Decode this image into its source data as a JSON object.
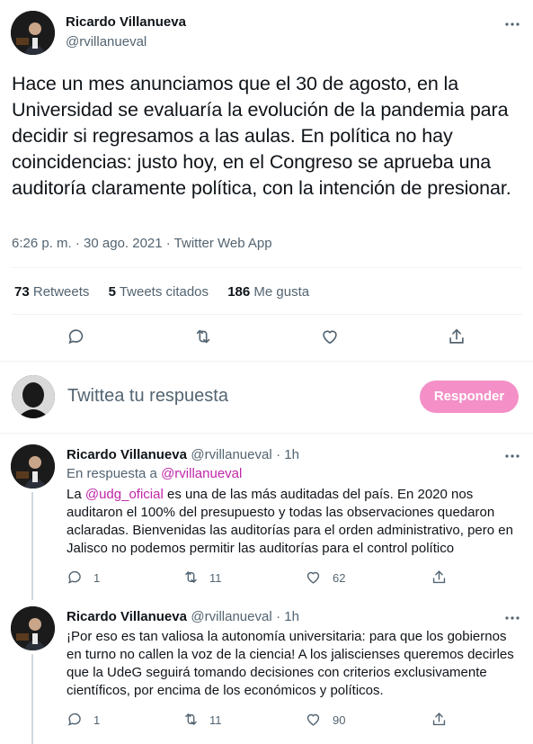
{
  "main_tweet": {
    "author_name": "Ricardo Villanueva",
    "author_handle": "@rvillanueval",
    "text": "Hace un mes anunciamos que el 30 de agosto, en la Universidad se evaluaría la evolución de la pandemia para decidir si regresamos a las aulas. En política no hay coincidencias: justo hoy, en el Congreso se aprueba una auditoría claramente política, con la intención de presionar.",
    "timestamp": "6:26 p. m. · 30 ago. 2021 · Twitter Web App",
    "stats": {
      "retweets_count": "73",
      "retweets_label": "Retweets",
      "quotes_count": "5",
      "quotes_label": "Tweets citados",
      "likes_count": "186",
      "likes_label": "Me gusta"
    },
    "more_icon": "more-dots-icon"
  },
  "composer": {
    "placeholder": "Twittea tu respuesta",
    "reply_button": "Responder"
  },
  "replies": [
    {
      "author_name": "Ricardo Villanueva",
      "author_handle": "@rvillanueval",
      "time": "· 1h",
      "in_reply_prefix": "En respuesta a",
      "in_reply_handle": "@rvillanueval",
      "text_prefix": "La",
      "mention": "@udg_oficial",
      "text": "es una de las más auditadas del país. En 2020 nos auditaron el 100% del presupuesto y todas las observaciones quedaron aclaradas. Bienvenidas las auditorías para el orden administrativo, pero en Jalisco no podemos permitir las auditorías para el control político",
      "reply_count": "1",
      "retweet_count": "11",
      "like_count": "62"
    },
    {
      "author_name": "Ricardo Villanueva",
      "author_handle": "@rvillanueval",
      "time": "· 1h",
      "text": "¡Por eso es tan valiosa la autonomía universitaria: para que los gobiernos en turno no callen la voz de la ciencia! A los jaliscienses queremos decirles que la UdeG seguirá tomando decisiones con criterios exclusivamente científicos, por encima de los económicos y políticos.",
      "reply_count": "1",
      "retweet_count": "11",
      "like_count": "90"
    }
  ],
  "colors": {
    "accent_link": "#c026a8",
    "reply_button_bg": "#f48fc7",
    "secondary_text": "#536471",
    "divider": "#eff3f4"
  }
}
